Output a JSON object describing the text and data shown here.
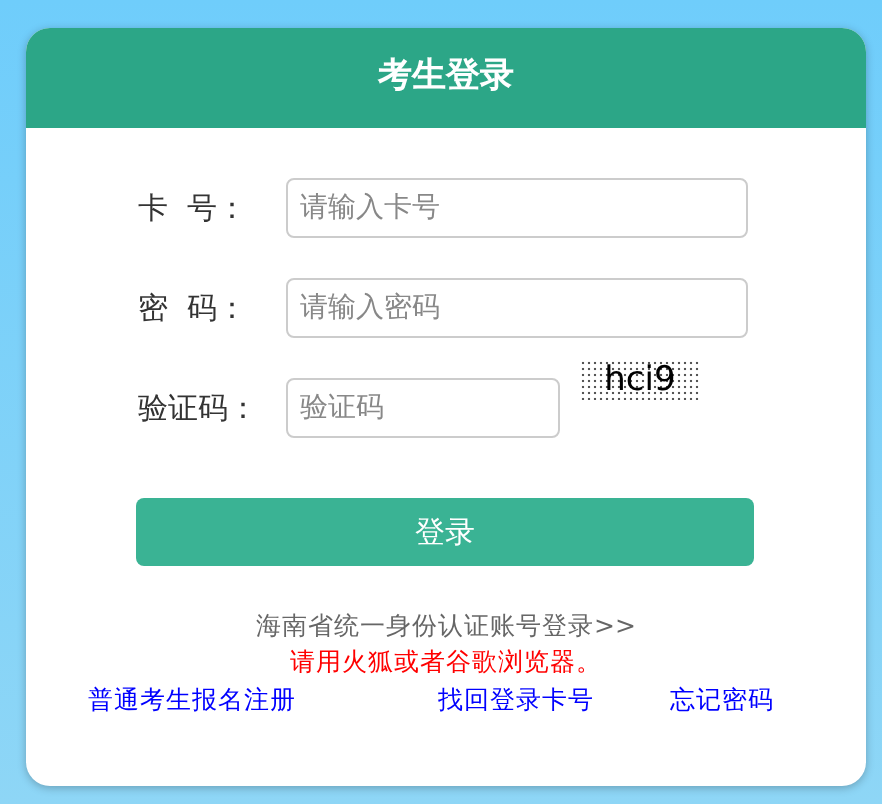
{
  "title": "考生登录",
  "fields": [
    {
      "label": "卡  号：",
      "placeholder": "请输入卡号",
      "kind": "wide"
    },
    {
      "label": "密  码：",
      "placeholder": "请输入密码",
      "kind": "wide"
    },
    {
      "label": "验证码：",
      "placeholder": "验证码",
      "kind": "captcha",
      "captcha": "hci9"
    }
  ],
  "login_button": "登录",
  "unified_login_link": "海南省统一身份认证账号登录>>",
  "browser_notice": "请用火狐或者谷歌浏览器。",
  "links": [
    "普通考生报名注册",
    "找回登录卡号",
    "忘记密码"
  ]
}
